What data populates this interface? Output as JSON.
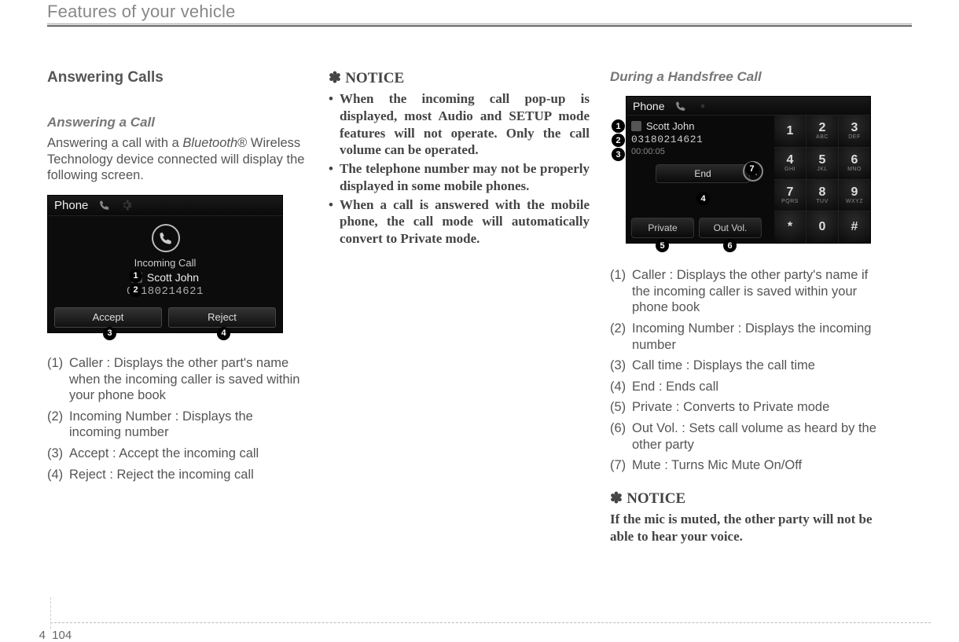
{
  "header": {
    "title": "Features of your vehicle"
  },
  "footer": {
    "section": "4",
    "page": "104"
  },
  "col1": {
    "heading": "Answering Calls",
    "sub": "Answering a Call",
    "para_a": "Answering a call with a ",
    "para_bt": "Bluetooth",
    "para_reg": "®",
    "para_b": " Wireless Technology device connected will display the following screen.",
    "fig": {
      "title": "Phone",
      "incoming": "Incoming Call",
      "caller": "Scott John",
      "number": "03180214621",
      "accept": "Accept",
      "reject": "Reject"
    },
    "list": [
      {
        "n": "(1)",
        "t": "Caller : Displays the other part's name when the incoming caller is saved within your phone book"
      },
      {
        "n": "(2)",
        "t": "Incoming Number : Displays the incoming number"
      },
      {
        "n": "(3)",
        "t": "Accept : Accept the incoming call"
      },
      {
        "n": "(4)",
        "t": "Reject : Reject the incoming call"
      }
    ]
  },
  "col2": {
    "notice": "NOTICE",
    "items": [
      "When the incoming call pop-up is displayed, most Audio and SETUP mode features will not operate. Only the call volume can be operated.",
      "The telephone number may not be properly displayed in some mobile phones.",
      "When a call is answered with the mobile phone, the call mode will automatically convert to Private mode."
    ]
  },
  "col3": {
    "sub": "During a Handsfree Call",
    "fig": {
      "title": "Phone",
      "caller": "Scott John",
      "number": "03180214621",
      "time": "00:00:05",
      "end": "End",
      "private": "Private",
      "outvol": "Out Vol.",
      "keys": [
        {
          "d": "1",
          "l": ""
        },
        {
          "d": "2",
          "l": "ABC"
        },
        {
          "d": "3",
          "l": "DEF"
        },
        {
          "d": "4",
          "l": "GHI"
        },
        {
          "d": "5",
          "l": "JKL"
        },
        {
          "d": "6",
          "l": "MNO"
        },
        {
          "d": "7",
          "l": "PQRS"
        },
        {
          "d": "8",
          "l": "TUV"
        },
        {
          "d": "9",
          "l": "WXYZ"
        },
        {
          "d": "*",
          "l": ""
        },
        {
          "d": "0",
          "l": ""
        },
        {
          "d": "#",
          "l": ""
        }
      ]
    },
    "list": [
      {
        "n": "(1)",
        "t": "Caller : Displays the other party's name if the incoming caller is saved within your phone book"
      },
      {
        "n": "(2)",
        "t": "Incoming Number : Displays the incoming number"
      },
      {
        "n": "(3)",
        "t": "Call time : Displays the call time"
      },
      {
        "n": "(4)",
        "t": "End : Ends call"
      },
      {
        "n": "(5)",
        "t": "Private : Converts to Private mode"
      },
      {
        "n": "(6)",
        "t": "Out Vol. : Sets call volume as heard by the other party"
      },
      {
        "n": "(7)",
        "t": "Mute : Turns Mic Mute On/Off"
      }
    ],
    "notice": "NOTICE",
    "notice_text": "If the mic is muted, the other party will not be able to hear your voice."
  }
}
